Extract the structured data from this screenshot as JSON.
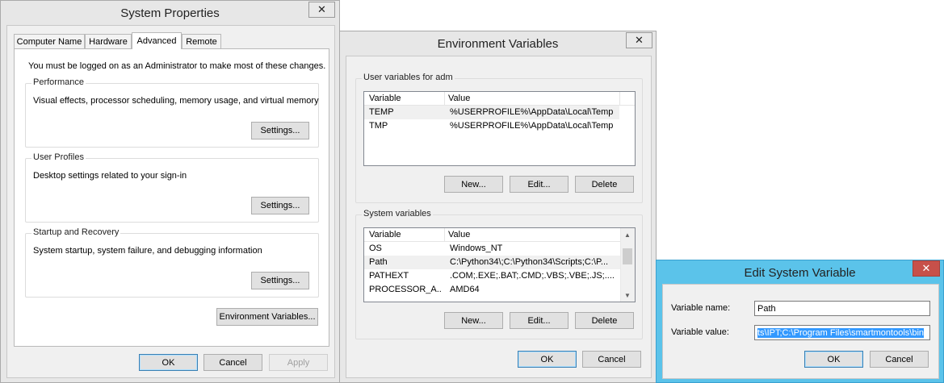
{
  "sysprops": {
    "title": "System Properties",
    "tabs": [
      "Computer Name",
      "Hardware",
      "Advanced",
      "Remote"
    ],
    "admin_note": "You must be logged on as an Administrator to make most of these changes.",
    "performance": {
      "legend": "Performance",
      "desc": "Visual effects, processor scheduling, memory usage, and virtual memory",
      "btn": "Settings..."
    },
    "profiles": {
      "legend": "User Profiles",
      "desc": "Desktop settings related to your sign-in",
      "btn": "Settings..."
    },
    "startup": {
      "legend": "Startup and Recovery",
      "desc": "System startup, system failure, and debugging information",
      "btn": "Settings..."
    },
    "env_btn": "Environment Variables...",
    "ok": "OK",
    "cancel": "Cancel",
    "apply": "Apply"
  },
  "envvars": {
    "title": "Environment Variables",
    "user_legend": "User variables for adm",
    "col_variable": "Variable",
    "col_value": "Value",
    "user_rows": [
      {
        "variable": "TEMP",
        "value": "%USERPROFILE%\\AppData\\Local\\Temp"
      },
      {
        "variable": "TMP",
        "value": "%USERPROFILE%\\AppData\\Local\\Temp"
      }
    ],
    "sys_legend": "System variables",
    "sys_rows": [
      {
        "variable": "OS",
        "value": "Windows_NT"
      },
      {
        "variable": "Path",
        "value": "C:\\Python34\\;C:\\Python34\\Scripts;C:\\P..."
      },
      {
        "variable": "PATHEXT",
        "value": ".COM;.EXE;.BAT;.CMD;.VBS;.VBE;.JS;...."
      },
      {
        "variable": "PROCESSOR_A...",
        "value": "AMD64"
      }
    ],
    "new": "New...",
    "edit": "Edit...",
    "delete": "Delete",
    "ok": "OK",
    "cancel": "Cancel"
  },
  "editvar": {
    "title": "Edit System Variable",
    "name_label": "Variable name:",
    "name_value": "Path",
    "value_label": "Variable value:",
    "value_value": "ts\\IPT;C:\\Program Files\\smartmontools\\bin",
    "ok": "OK",
    "cancel": "Cancel"
  },
  "icons": {
    "close": "close-icon",
    "scroll_up": "scroll-up-arrow-icon",
    "scroll_down": "scroll-down-arrow-icon"
  },
  "colors": {
    "selection": "#3399ff",
    "edit_frame": "#5bc3ea",
    "close_red": "#c7504a"
  }
}
